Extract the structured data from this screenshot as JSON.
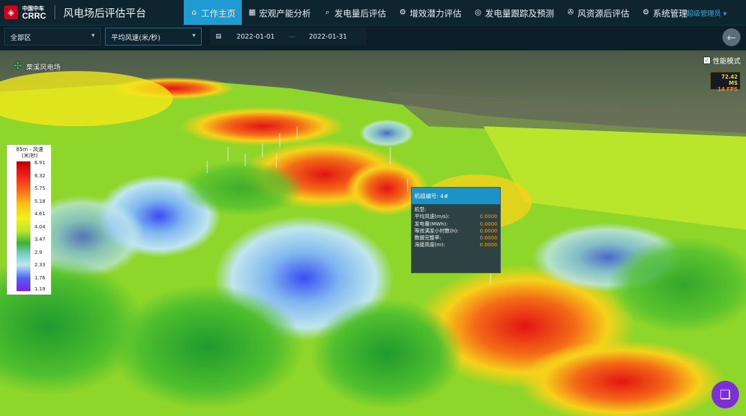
{
  "logo": {
    "cn": "中国中车",
    "en": "CRRC"
  },
  "app_title": "风电场后评估平台",
  "nav": [
    {
      "label": "工作主页",
      "icon": "home-icon",
      "glyph": "⌂"
    },
    {
      "label": "宏观产能分析",
      "icon": "grid-icon",
      "glyph": "▦"
    },
    {
      "label": "发电量后评估",
      "icon": "search-icon",
      "glyph": "⌕"
    },
    {
      "label": "增效潜力评估",
      "icon": "gear-icon",
      "glyph": "⚙"
    },
    {
      "label": "发电量跟踪及预测",
      "icon": "target-icon",
      "glyph": "◎"
    },
    {
      "label": "风资源后评估",
      "icon": "fan-icon",
      "glyph": "✇"
    },
    {
      "label": "系统管理",
      "icon": "gear-icon",
      "glyph": "⚙"
    }
  ],
  "user": "超级管理员",
  "filters": {
    "region": "全部区",
    "metric": "平均风速(米/秒)",
    "date_start": "2022-01-01",
    "date_sep": "—",
    "date_end": "2022-01-31"
  },
  "site_name": "栗溪风电场",
  "perf_mode": {
    "label": "性能模式",
    "checked": true
  },
  "stats": {
    "ms": "72.42 MS",
    "fps": "14 FPS"
  },
  "legend": {
    "title": "85m - 风速\n(米/秒)",
    "ticks": [
      "6.91",
      "6.32",
      "5.75",
      "5.18",
      "4.61",
      "4.04",
      "3.47",
      "2.9",
      "2.33",
      "1.76",
      "1.19"
    ]
  },
  "popup": {
    "title": "机组编号: 4#",
    "rows": [
      {
        "label": "机型:",
        "value": ""
      },
      {
        "label": "平均风速(m/s):",
        "value": "0.0000"
      },
      {
        "label": "发电量(MWh):",
        "value": "0.0000"
      },
      {
        "label": "等效满发小时数(h):",
        "value": "0.0000"
      },
      {
        "label": "数据完整率:",
        "value": "0.0000"
      },
      {
        "label": "海拔高度(m):",
        "value": "0.0000"
      }
    ]
  },
  "colors": {
    "accent": "#1e9bd0",
    "header_bg": "#0e2530",
    "fab": "#7b2fd8"
  }
}
